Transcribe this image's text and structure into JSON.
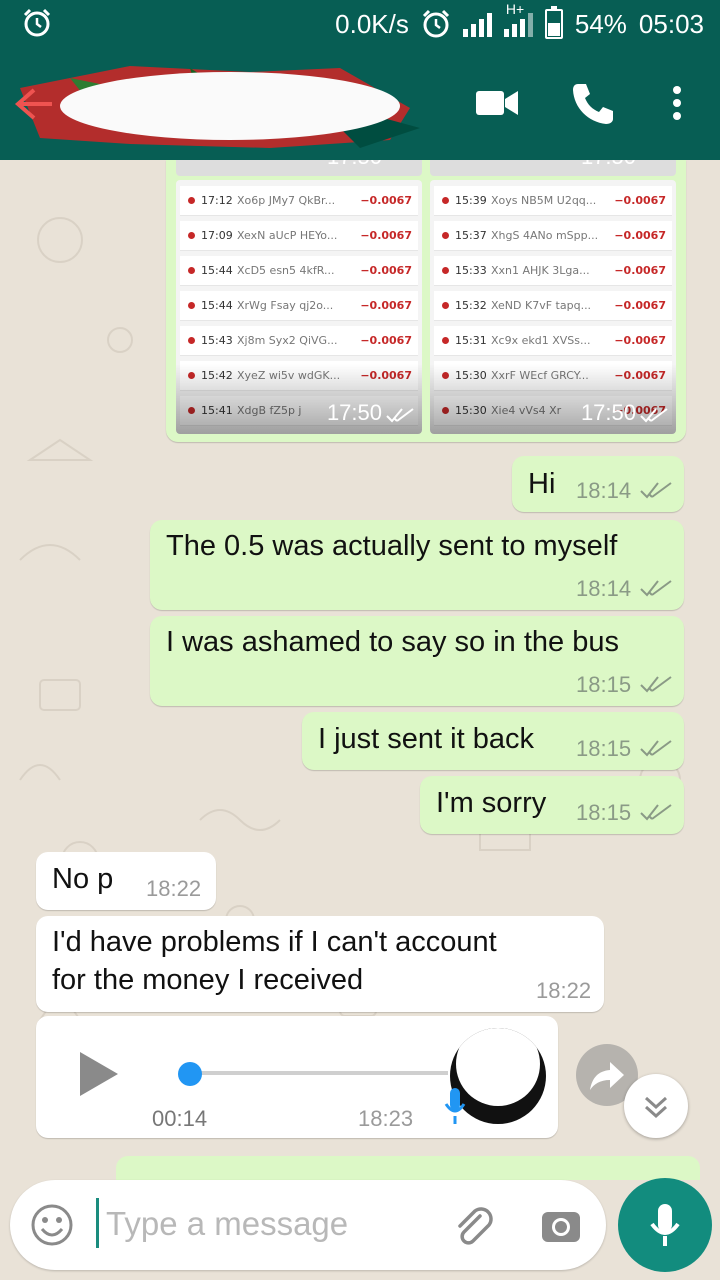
{
  "status_bar": {
    "net_speed": "0.0K/s",
    "battery": "54%",
    "battery_level": 0.54,
    "clock": "05:03",
    "network_type": "H+",
    "icons": [
      "alarm-icon",
      "alarm-icon",
      "signal-icon",
      "signal-icon",
      "battery-icon"
    ]
  },
  "app_bar": {
    "icons": [
      "back-arrow-icon",
      "video-call-icon",
      "phone-call-icon",
      "more-options-icon"
    ]
  },
  "image_messages": {
    "left": {
      "time": "17:50",
      "rows": [
        {
          "time": "17:12",
          "name": "Xo6p JMy7 QkBr...",
          "amount": "−0.0067"
        },
        {
          "time": "17:09",
          "name": "XexN aUcP HEYo...",
          "amount": "−0.0067"
        },
        {
          "time": "15:44",
          "name": "XcD5 esn5 4kfR...",
          "amount": "−0.0067"
        },
        {
          "time": "15:44",
          "name": "XrWg Fsay qj2o...",
          "amount": "−0.0067"
        },
        {
          "time": "15:43",
          "name": "Xj8m Syx2 QiVG...",
          "amount": "−0.0067"
        },
        {
          "time": "15:42",
          "name": "XyeZ wi5v wdGK...",
          "amount": "−0.0067"
        },
        {
          "time": "15:41",
          "name": "XdgB fZ5p j",
          "amount": ""
        }
      ]
    },
    "right": {
      "time": "17:50",
      "rows": [
        {
          "time": "15:39",
          "name": "Xoys NB5M U2qq...",
          "amount": "−0.0067"
        },
        {
          "time": "15:37",
          "name": "XhgS 4ANo mSpp...",
          "amount": "−0.0067"
        },
        {
          "time": "15:33",
          "name": "Xxn1 AHJK 3Lga...",
          "amount": "−0.0067"
        },
        {
          "time": "15:32",
          "name": "XeND K7vF tapq...",
          "amount": "−0.0067"
        },
        {
          "time": "15:31",
          "name": "Xc9x ekd1 XVSs...",
          "amount": "−0.0067"
        },
        {
          "time": "15:30",
          "name": "XxrF WEcf GRCY...",
          "amount": "−0.0067"
        },
        {
          "time": "15:30",
          "name": "Xie4 vVs4 Xr",
          "amount": "−0.0067"
        }
      ]
    },
    "top_left_time": "17:50",
    "top_right_time": "17:50"
  },
  "messages": [
    {
      "dir": "out",
      "text": "Hi",
      "time": "18:14"
    },
    {
      "dir": "out",
      "text": "The 0.5 was actually sent to myself",
      "time": "18:14"
    },
    {
      "dir": "out",
      "text": "I was ashamed to say so in the bus",
      "time": "18:15"
    },
    {
      "dir": "out",
      "text": "I just sent it back",
      "time": "18:15"
    },
    {
      "dir": "out",
      "text": "I'm sorry",
      "time": "18:15"
    },
    {
      "dir": "in",
      "text": "No p",
      "time": "18:22"
    },
    {
      "dir": "in",
      "line1": "I'd have problems if I can't account",
      "line2": "for the money I received",
      "time": "18:22"
    }
  ],
  "voice_note": {
    "duration": "00:14",
    "time": "18:23",
    "progress": 0.0
  },
  "input": {
    "placeholder": "Type a message"
  },
  "colors": {
    "header": "#075e54",
    "outgoing_bubble": "#dcf8c6",
    "incoming_bubble": "#ffffff",
    "chat_background": "#e9e2d7",
    "mic_button": "#128c7e",
    "read_ticks": "#8a9a86"
  }
}
